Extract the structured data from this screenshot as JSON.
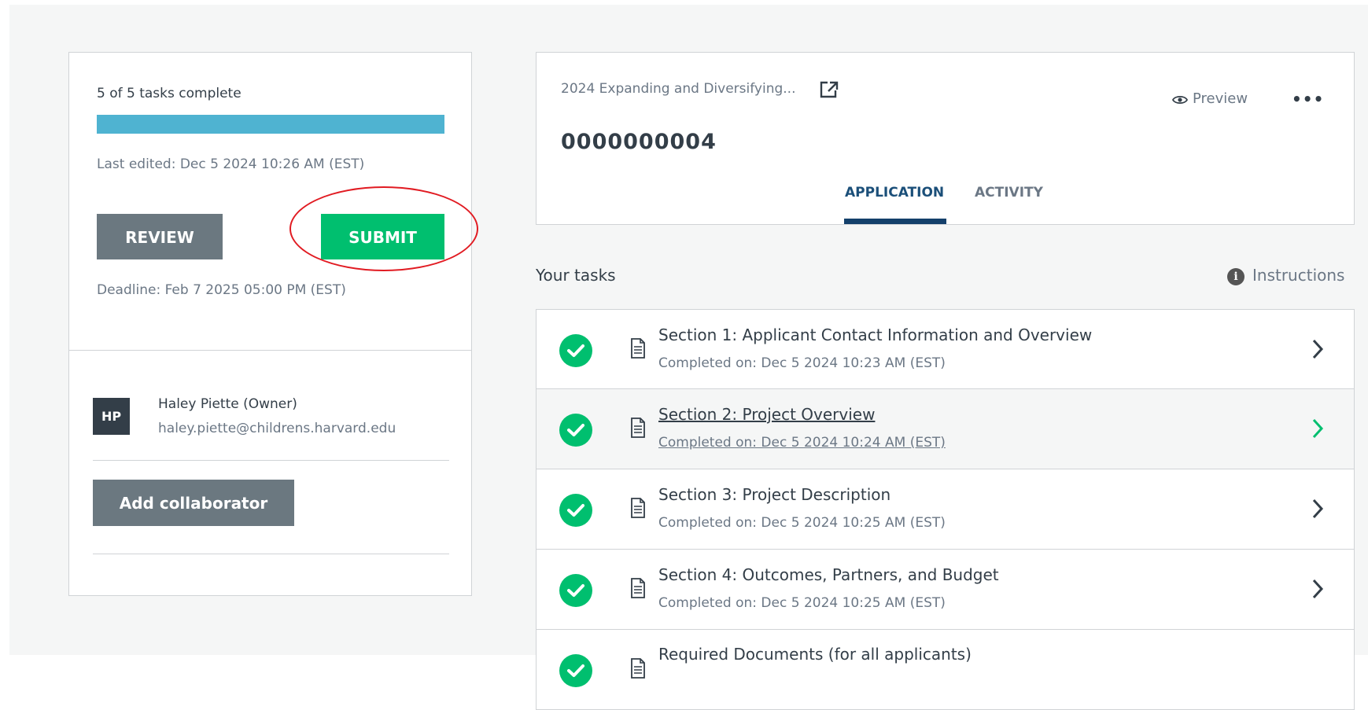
{
  "left_panel": {
    "progress_text": "5 of 5 tasks complete",
    "progress_fraction": 1.0,
    "last_edited": "Last edited: Dec 5 2024 10:26 AM (EST)",
    "review_label": "REVIEW",
    "submit_label": "SUBMIT",
    "deadline": "Deadline: Feb 7 2025 05:00 PM (EST)",
    "collaborator": {
      "initials": "HP",
      "name": "Haley Piette (Owner)",
      "email": "haley.piette@childrens.harvard.edu"
    },
    "add_collaborator_label": "Add collaborator"
  },
  "header": {
    "form_name": "2024 Expanding and Diversifying...",
    "preview_label": "Preview",
    "app_number": "0000000004",
    "tabs": [
      {
        "label": "APPLICATION",
        "active": true
      },
      {
        "label": "ACTIVITY",
        "active": false
      }
    ]
  },
  "tasks": {
    "heading": "Your tasks",
    "instructions_label": "Instructions",
    "items": [
      {
        "title": "Section 1: Applicant Contact Information and Overview",
        "completed": "Completed on: Dec 5 2024 10:23 AM (EST)"
      },
      {
        "title": "Section 2: Project Overview",
        "completed": "Completed on: Dec 5 2024 10:24 AM (EST)"
      },
      {
        "title": "Section 3: Project Description",
        "completed": "Completed on: Dec 5 2024 10:25 AM (EST)"
      },
      {
        "title": "Section 4: Outcomes, Partners, and Budget",
        "completed": "Completed on: Dec 5 2024 10:25 AM (EST)"
      },
      {
        "title": "Required Documents (for all applicants)",
        "completed": ""
      }
    ]
  },
  "colors": {
    "accent_green": "#00bf6f",
    "progress_blue": "#4fb3d1",
    "tab_active": "#1b4f79",
    "annotation_red": "#e11b22"
  }
}
